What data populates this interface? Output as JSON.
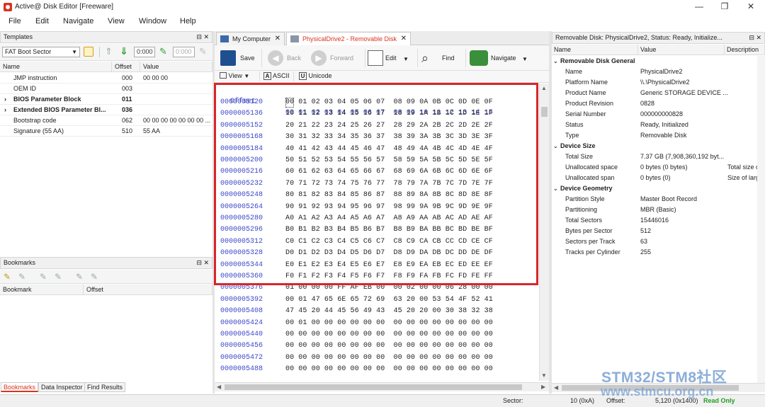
{
  "window": {
    "title": "Active@ Disk Editor [Freeware]",
    "minimize": "—",
    "restore": "❐",
    "close": "✕"
  },
  "menu": [
    "File",
    "Edit",
    "Navigate",
    "View",
    "Window",
    "Help"
  ],
  "templates": {
    "title": "Templates",
    "selected_template": "FAT Boot Sector",
    "offset_input": "0:000",
    "offset_input2": "0:000",
    "columns": [
      "Name",
      "Offset",
      "Value"
    ],
    "rows": [
      {
        "name": "JMP instruction",
        "offset": "000",
        "value": "00 00 00",
        "expandable": false,
        "bold": false
      },
      {
        "name": "OEM ID",
        "offset": "003",
        "value": "",
        "expandable": false,
        "bold": false
      },
      {
        "name": "BIOS Parameter Block",
        "offset": "011",
        "value": "",
        "expandable": true,
        "bold": true
      },
      {
        "name": "Extended BIOS Parameter Bl...",
        "offset": "036",
        "value": "",
        "expandable": true,
        "bold": true
      },
      {
        "name": "Bootstrap code",
        "offset": "062",
        "value": "00 00 00 00 00 00 00 ...",
        "expandable": false,
        "bold": false
      },
      {
        "name": "Signature (55 AA)",
        "offset": "510",
        "value": "55 AA",
        "expandable": false,
        "bold": false
      }
    ]
  },
  "bookmarks": {
    "title": "Bookmarks",
    "columns": [
      "Bookmark",
      "Offset"
    ]
  },
  "bottom_tabs": [
    "Bookmarks",
    "Data Inspector",
    "Find Results"
  ],
  "tabs": [
    {
      "label": "My Computer",
      "active": false
    },
    {
      "label": "PhysicalDrive2 - Removable Disk",
      "active": true
    }
  ],
  "toolbar": {
    "save": "Save",
    "back": "Back",
    "forward": "Forward",
    "edit": "Edit",
    "find": "Find",
    "navigate": "Navigate",
    "view": "View",
    "ascii": "ASCII",
    "unicode": "Unicode"
  },
  "hex": {
    "header_label": "Offset",
    "header_bytes": "00 01 02 03 04 05 06 07  08 09 10 11 12 13 14 15",
    "rows": [
      {
        "offset": "0000005120",
        "bytes": "00 01 02 03 04 05 06 07  08 09 0A 0B 0C 0D 0E 0F"
      },
      {
        "offset": "0000005136",
        "bytes": "10 11 12 13 14 15 16 17  18 19 1A 1B 1C 1D 1E 1F"
      },
      {
        "offset": "0000005152",
        "bytes": "20 21 22 23 24 25 26 27  28 29 2A 2B 2C 2D 2E 2F"
      },
      {
        "offset": "0000005168",
        "bytes": "30 31 32 33 34 35 36 37  38 39 3A 3B 3C 3D 3E 3F"
      },
      {
        "offset": "0000005184",
        "bytes": "40 41 42 43 44 45 46 47  48 49 4A 4B 4C 4D 4E 4F"
      },
      {
        "offset": "0000005200",
        "bytes": "50 51 52 53 54 55 56 57  58 59 5A 5B 5C 5D 5E 5F"
      },
      {
        "offset": "0000005216",
        "bytes": "60 61 62 63 64 65 66 67  68 69 6A 6B 6C 6D 6E 6F"
      },
      {
        "offset": "0000005232",
        "bytes": "70 71 72 73 74 75 76 77  78 79 7A 7B 7C 7D 7E 7F"
      },
      {
        "offset": "0000005248",
        "bytes": "80 81 82 83 84 85 86 87  88 89 8A 8B 8C 8D 8E 8F"
      },
      {
        "offset": "0000005264",
        "bytes": "90 91 92 93 94 95 96 97  98 99 9A 9B 9C 9D 9E 9F"
      },
      {
        "offset": "0000005280",
        "bytes": "A0 A1 A2 A3 A4 A5 A6 A7  A8 A9 AA AB AC AD AE AF"
      },
      {
        "offset": "0000005296",
        "bytes": "B0 B1 B2 B3 B4 B5 B6 B7  B8 B9 BA BB BC BD BE BF"
      },
      {
        "offset": "0000005312",
        "bytes": "C0 C1 C2 C3 C4 C5 C6 C7  C8 C9 CA CB CC CD CE CF"
      },
      {
        "offset": "0000005328",
        "bytes": "D0 D1 D2 D3 D4 D5 D6 D7  D8 D9 DA DB DC DD DE DF"
      },
      {
        "offset": "0000005344",
        "bytes": "E0 E1 E2 E3 E4 E5 E6 E7  E8 E9 EA EB EC ED EE EF"
      },
      {
        "offset": "0000005360",
        "bytes": "F0 F1 F2 F3 F4 F5 F6 F7  F8 F9 FA FB FC FD FE FF"
      },
      {
        "offset": "0000005376",
        "bytes": "01 00 00 00 FF AF EB 00  00 02 00 00 06 28 00 00"
      },
      {
        "offset": "0000005392",
        "bytes": "00 01 47 65 6E 65 72 69  63 20 00 53 54 4F 52 41"
      },
      {
        "offset": "0000005408",
        "bytes": "47 45 20 44 45 56 49 43  45 20 20 00 30 38 32 38"
      },
      {
        "offset": "0000005424",
        "bytes": "00 01 00 00 00 00 00 00  00 00 00 00 00 00 00 00"
      },
      {
        "offset": "0000005440",
        "bytes": "00 00 00 00 00 00 00 00  00 00 00 00 00 00 00 00"
      },
      {
        "offset": "0000005456",
        "bytes": "00 00 00 00 00 00 00 00  00 00 00 00 00 00 00 00"
      },
      {
        "offset": "0000005472",
        "bytes": "00 00 00 00 00 00 00 00  00 00 00 00 00 00 00 00"
      },
      {
        "offset": "0000005488",
        "bytes": "00 00 00 00 00 00 00 00  00 00 00 00 00 00 00 00"
      }
    ]
  },
  "properties": {
    "title": "Removable Disk: PhysicalDrive2, Status: Ready, Initialize...",
    "columns": [
      "Name",
      "Value",
      "Description"
    ],
    "groups": [
      {
        "name": "Removable Disk General",
        "items": [
          {
            "name": "Name",
            "value": "PhysicalDrive2",
            "desc": ""
          },
          {
            "name": "Platform Name",
            "value": "\\\\.\\PhysicalDrive2",
            "desc": ""
          },
          {
            "name": "Product Name",
            "value": "Generic STORAGE DEVICE ...",
            "desc": ""
          },
          {
            "name": "Product Revision",
            "value": "0828",
            "desc": ""
          },
          {
            "name": "Serial Number",
            "value": "000000000828",
            "desc": ""
          },
          {
            "name": "Status",
            "value": "Ready, Initialized",
            "desc": ""
          },
          {
            "name": "Type",
            "value": "Removable Disk",
            "desc": ""
          }
        ]
      },
      {
        "name": "Device Size",
        "items": [
          {
            "name": "Total Size",
            "value": "7.37 GB (7,908,360,192 byt...",
            "desc": ""
          },
          {
            "name": "Unallocated space",
            "value": "0 bytes (0 bytes)",
            "desc": "Total size of"
          },
          {
            "name": "Unallocated span",
            "value": "0 bytes (0)",
            "desc": "Size of larges"
          }
        ]
      },
      {
        "name": "Device Geometry",
        "items": [
          {
            "name": "Partition Style",
            "value": "Master Boot Record",
            "desc": ""
          },
          {
            "name": "Partitioning",
            "value": "MBR (Basic)",
            "desc": ""
          },
          {
            "name": "Total Sectors",
            "value": "15446016",
            "desc": ""
          },
          {
            "name": "Bytes per Sector",
            "value": "512",
            "desc": ""
          },
          {
            "name": "Sectors per Track",
            "value": "63",
            "desc": ""
          },
          {
            "name": "Tracks per Cylinder",
            "value": "255",
            "desc": ""
          }
        ]
      }
    ]
  },
  "status": {
    "sector_label": "Sector:",
    "sector_value": "10 (0xA)",
    "offset_label": "Offset:",
    "offset_value": "5,120 (0x1400)",
    "mode": "Read Only"
  },
  "watermark": {
    "line1": "STM32/STM8社区",
    "line2": "www.stmcu.org.cn"
  },
  "colors": {
    "highlight_border": "#d7262b",
    "offset_text": "#3b48c8",
    "active_tab_text": "#d9331f",
    "read_only": "#1f9d1f"
  }
}
